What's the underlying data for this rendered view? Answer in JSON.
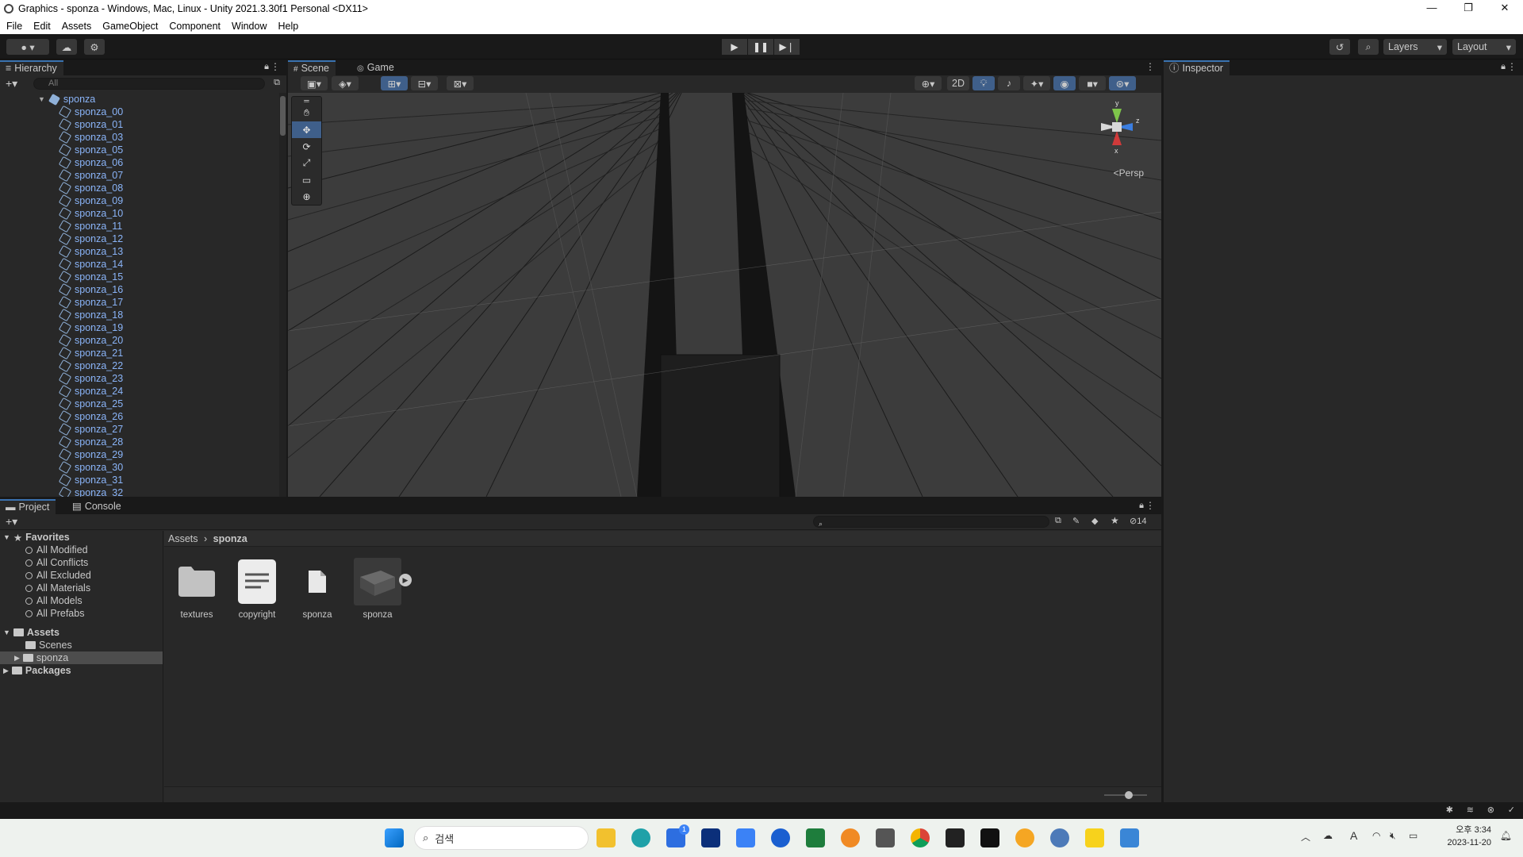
{
  "window": {
    "title": "Graphics - sponza - Windows, Mac, Linux - Unity 2021.3.30f1 Personal <DX11>",
    "minimize": "—",
    "maximize": "❐",
    "close": "✕"
  },
  "menu": [
    "File",
    "Edit",
    "Assets",
    "GameObject",
    "Component",
    "Window",
    "Help"
  ],
  "toolbar": {
    "layers_label": "Layers",
    "layout_label": "Layout",
    "play": "▶",
    "pause": "❚❚",
    "step": "▶❘"
  },
  "hierarchy": {
    "tab": "Hierarchy",
    "search_placeholder": "All",
    "root": "sponza",
    "children": [
      "sponza_00",
      "sponza_01",
      "sponza_03",
      "sponza_05",
      "sponza_06",
      "sponza_07",
      "sponza_08",
      "sponza_09",
      "sponza_10",
      "sponza_11",
      "sponza_12",
      "sponza_13",
      "sponza_14",
      "sponza_15",
      "sponza_16",
      "sponza_17",
      "sponza_18",
      "sponza_19",
      "sponza_20",
      "sponza_21",
      "sponza_22",
      "sponza_23",
      "sponza_24",
      "sponza_25",
      "sponza_26",
      "sponza_27",
      "sponza_28",
      "sponza_29",
      "sponza_30",
      "sponza_31",
      "sponza_32"
    ]
  },
  "scene": {
    "tab_scene": "Scene",
    "tab_game": "Game",
    "btn_2d": "2D",
    "persp_label": "Persp",
    "gizmo_y": "y",
    "gizmo_z": "z",
    "gizmo_x": "x"
  },
  "inspector": {
    "tab": "Inspector"
  },
  "project": {
    "tab_project": "Project",
    "tab_console": "Console",
    "hidden_count": "14",
    "favorites_label": "Favorites",
    "favorites": [
      "All Modified",
      "All Conflicts",
      "All Excluded",
      "All Materials",
      "All Models",
      "All Prefabs"
    ],
    "assets_label": "Assets",
    "assets_children": [
      "Scenes",
      "sponza"
    ],
    "packages_label": "Packages",
    "breadcrumb": [
      "Assets",
      "sponza"
    ],
    "items": [
      {
        "name": "textures",
        "kind": "folder"
      },
      {
        "name": "copyright",
        "kind": "text-document"
      },
      {
        "name": "sponza",
        "kind": "file"
      },
      {
        "name": "sponza",
        "kind": "model"
      }
    ]
  },
  "taskbar": {
    "search_placeholder": "검색",
    "time": "오후 3:34",
    "date": "2023-11-20",
    "badge": "1"
  }
}
